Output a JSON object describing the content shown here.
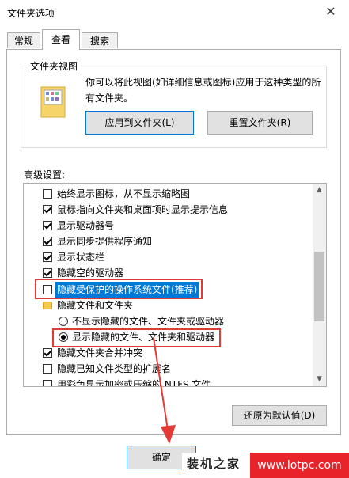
{
  "window": {
    "title": "文件夹选项",
    "close_glyph": "✕"
  },
  "tabs": [
    {
      "label": "常规",
      "active": false
    },
    {
      "label": "查看",
      "active": true
    },
    {
      "label": "搜索",
      "active": false
    }
  ],
  "folder_views": {
    "legend": "文件夹视图",
    "description": "你可以将此视图(如详细信息或图标)应用于这种类型的所有文件夹。",
    "apply_label": "应用到文件夹(L)",
    "reset_label": "重置文件夹(R)"
  },
  "advanced": {
    "label": "高级设置:",
    "items": [
      {
        "type": "checkbox",
        "checked": false,
        "text": "始终显示图标，从不显示缩略图",
        "indent": 1
      },
      {
        "type": "checkbox",
        "checked": true,
        "text": "鼠标指向文件夹和桌面项时显示提示信息",
        "indent": 1
      },
      {
        "type": "checkbox",
        "checked": true,
        "text": "显示驱动器号",
        "indent": 1
      },
      {
        "type": "checkbox",
        "checked": true,
        "text": "显示同步提供程序通知",
        "indent": 1
      },
      {
        "type": "checkbox",
        "checked": true,
        "text": "显示状态栏",
        "indent": 1
      },
      {
        "type": "checkbox",
        "checked": true,
        "text": "隐藏空的驱动器",
        "indent": 1
      },
      {
        "type": "checkbox",
        "checked": false,
        "text": "隐藏受保护的操作系统文件(推荐)",
        "indent": 1,
        "selected": true
      },
      {
        "type": "folder",
        "text": "隐藏文件和文件夹",
        "indent": 1
      },
      {
        "type": "radio",
        "checked": false,
        "text": "不显示隐藏的文件、文件夹或驱动器",
        "indent": 2
      },
      {
        "type": "radio",
        "checked": true,
        "text": "显示隐藏的文件、文件夹和驱动器",
        "indent": 2
      },
      {
        "type": "checkbox",
        "checked": true,
        "text": "隐藏文件夹合并冲突",
        "indent": 1
      },
      {
        "type": "checkbox",
        "checked": false,
        "text": "隐藏已知文件类型的扩展名",
        "indent": 1
      },
      {
        "type": "checkbox",
        "checked": false,
        "text": "用彩色显示加密或压缩的 NTFS 文件",
        "indent": 1
      }
    ],
    "restore_label": "还原为默认值(D)"
  },
  "footer": {
    "ok_label": "确定"
  },
  "watermark": {
    "text": "装机之家",
    "url": "www.lotpc.com"
  },
  "colors": {
    "accent": "#0078d7",
    "annotation": "#e53935"
  }
}
